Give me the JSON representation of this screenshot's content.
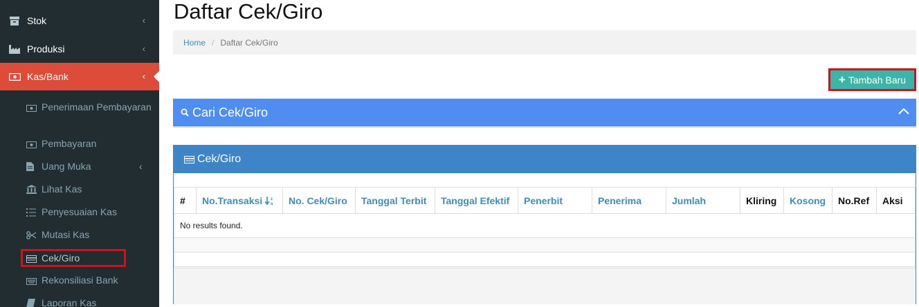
{
  "sidebar": {
    "menu": [
      {
        "label": "Stok",
        "icon": "archive-icon"
      },
      {
        "label": "Produksi",
        "icon": "industry-icon"
      },
      {
        "label": "Kas/Bank",
        "icon": "money-icon"
      }
    ],
    "submenu": [
      {
        "label": "Penerimaan Pembayaran",
        "icon": "money-icon"
      },
      {
        "label": "Pembayaran",
        "icon": "money-icon"
      },
      {
        "label": "Uang Muka",
        "icon": "file-icon"
      },
      {
        "label": "Lihat Kas",
        "icon": "bank-icon"
      },
      {
        "label": "Penyesuaian Kas",
        "icon": "list-icon"
      },
      {
        "label": "Mutasi Kas",
        "icon": "scissors-icon"
      },
      {
        "label": "Cek/Giro",
        "icon": "card-icon"
      },
      {
        "label": "Rekonsiliasi Bank",
        "icon": "keyboard-icon"
      },
      {
        "label": "Laporan Kas",
        "icon": "book-icon"
      }
    ]
  },
  "page": {
    "title": "Daftar Cek/Giro"
  },
  "breadcrumb": {
    "home": "Home",
    "sep": "/",
    "current": "Daftar Cek/Giro"
  },
  "toolbar": {
    "add_label": "Tambah Baru"
  },
  "search": {
    "title": "Cari Cek/Giro"
  },
  "panel": {
    "title": "Cek/Giro"
  },
  "table": {
    "columns": [
      "#",
      "No.Transaksi",
      "No. Cek/Giro",
      "Tanggal Terbit",
      "Tanggal Efektif",
      "Penerbit",
      "Penerima",
      "Jumlah",
      "Kliring",
      "Kosong",
      "No.Ref",
      "Aksi"
    ],
    "empty_text": "No results found."
  },
  "colors": {
    "sidebar": "#222d32",
    "active": "#dd4b39",
    "search_box": "#4f8ef0",
    "panel_header": "#3d85c6",
    "add_button": "#3bb5a9",
    "highlight": "#d0121b"
  }
}
